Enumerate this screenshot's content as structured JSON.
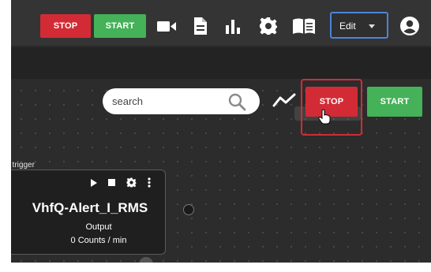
{
  "toolbar": {
    "stop_label": "STOP",
    "start_label": "START",
    "icons": [
      "video-camera-icon",
      "document-icon",
      "bar-chart-icon",
      "gear-icon",
      "book-icon",
      "user-icon"
    ],
    "mode_select": {
      "selected": "Edit"
    }
  },
  "canvas": {
    "search": {
      "placeholder": "search"
    },
    "stop_label": "STOP",
    "start_label": "START"
  },
  "node": {
    "trigger_label": "t trigger",
    "title": "VhfQ-Alert_I_RMS",
    "subtitle": "Output",
    "counts": "0 Counts / min"
  },
  "colors": {
    "stop": "#d32b35",
    "start": "#45b158",
    "select_border": "#4a86d8",
    "toolbar_bg": "#343434",
    "canvas_bg": "#2c2c2c"
  }
}
